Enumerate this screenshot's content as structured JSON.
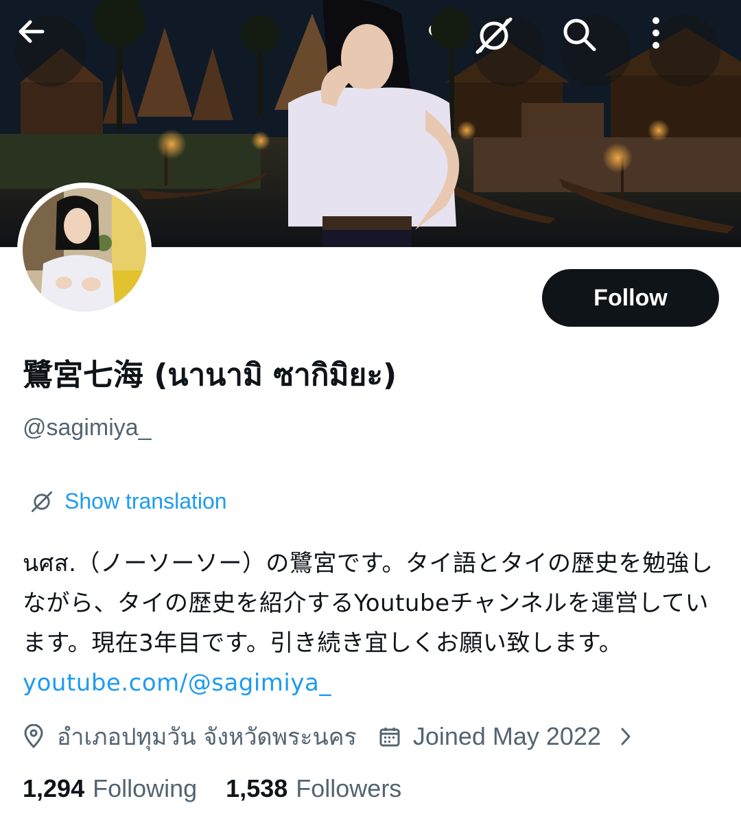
{
  "header": {
    "back_icon": "arrow-left-icon",
    "translate_icon": "translate-off-icon",
    "search_icon": "search-icon",
    "more_icon": "more-vertical-icon"
  },
  "profile": {
    "display_name": "鷺宮七海 (นานามิ ซากิมิยะ)",
    "handle": "@sagimiya_",
    "follow_label": "Follow",
    "show_translation": "Show translation",
    "bio_text": "นศส.（ノーソーソー）の鷺宮です。タイ語とタイの歴史を勉強しながら、タイの歴史を紹介するYoutubeチャンネルを運営しています。現在3年目です。引き続き宜しくお願い致します。",
    "bio_link": "youtube.com/@sagimiya_",
    "location": "อำเภอปทุมวัน จังหวัดพระนคร",
    "joined": "Joined May 2022",
    "following_count": "1,294",
    "following_label": "Following",
    "followers_count": "1,538",
    "followers_label": "Followers"
  },
  "colors": {
    "accent": "#1d9bf0",
    "text_primary": "#0f1419",
    "text_secondary": "#536471",
    "button_bg": "#0f1419"
  }
}
